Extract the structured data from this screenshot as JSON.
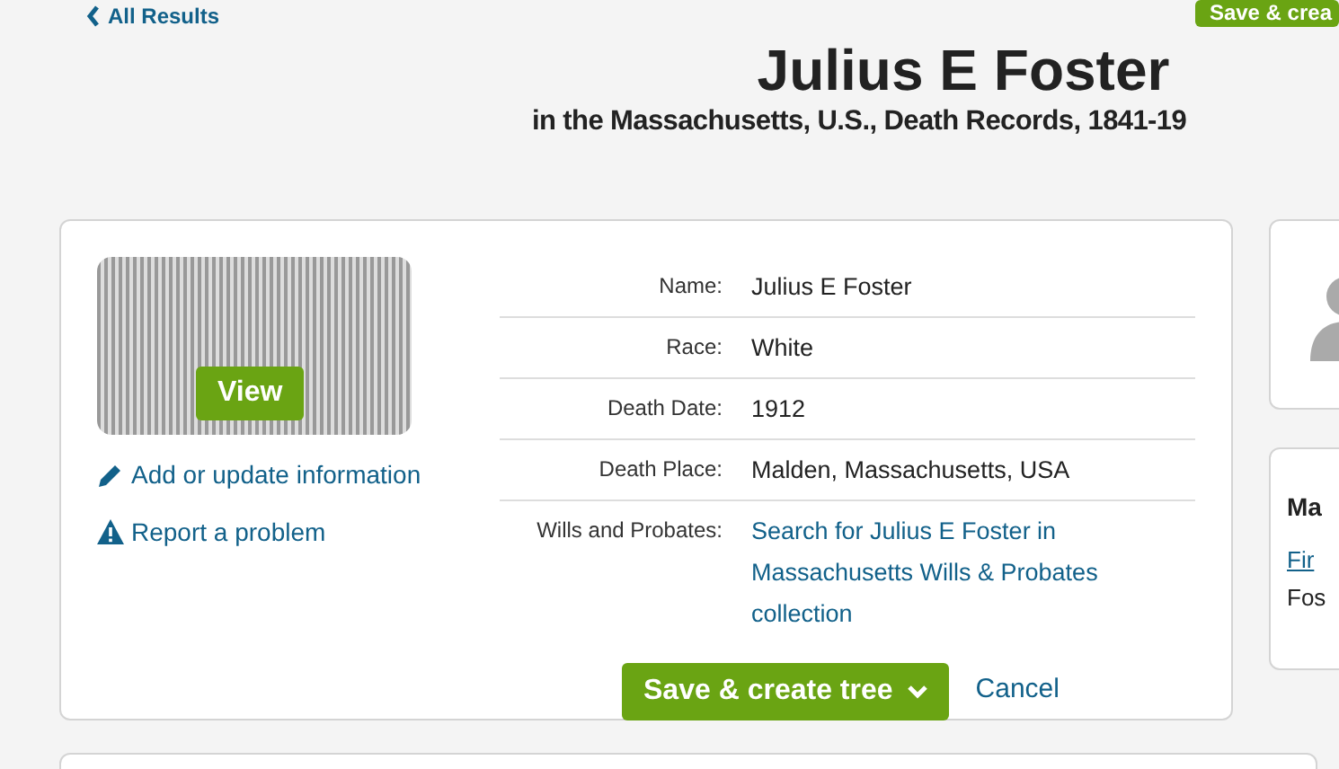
{
  "back_link": {
    "label": "All Results"
  },
  "top_button": {
    "label": "Save & crea"
  },
  "header": {
    "title": "Julius E Foster",
    "subtitle": "in the Massachusetts, U.S., Death Records, 1841-19"
  },
  "record": {
    "view_button": "View",
    "actions": [
      {
        "kind": "edit",
        "label": "Add or update information"
      },
      {
        "kind": "warning",
        "label": "Report a problem"
      }
    ],
    "fields": [
      {
        "label": "Name:",
        "value": "Julius E Foster",
        "kind": "text"
      },
      {
        "label": "Race:",
        "value": "White",
        "kind": "text"
      },
      {
        "label": "Death Date:",
        "value": "1912",
        "kind": "text"
      },
      {
        "label": "Death Place:",
        "value": "Malden, Massachusetts, USA",
        "kind": "text"
      },
      {
        "label": "Wills and Probates:",
        "value": "Search for Julius E Foster in Massachusetts Wills & Probates collection",
        "kind": "link"
      }
    ],
    "save_button": "Save & create tree",
    "cancel": "Cancel"
  },
  "side_card": {
    "heading": "Ma",
    "link": "Fir",
    "text": "Fos"
  }
}
